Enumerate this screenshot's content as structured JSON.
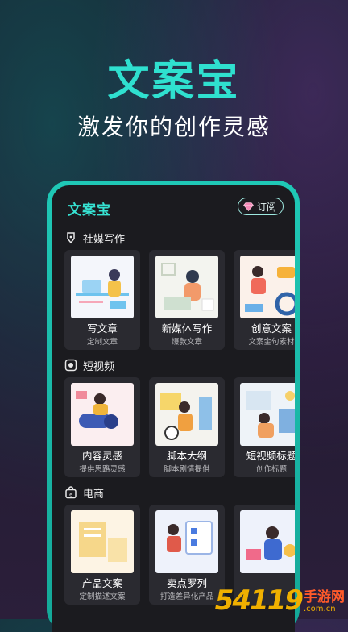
{
  "hero": {
    "title": "文案宝",
    "subtitle": "激发你的创作灵感"
  },
  "app": {
    "logo": "文案宝",
    "subscribe_label": "订阅"
  },
  "sections": [
    {
      "title": "社媒写作",
      "icon": "pen-nib-icon",
      "cards": [
        {
          "title": "写文章",
          "sub": "定制文章"
        },
        {
          "title": "新媒体写作",
          "sub": "爆款文章"
        },
        {
          "title": "创意文案",
          "sub": "文案金句素材"
        }
      ]
    },
    {
      "title": "短视频",
      "icon": "record-icon",
      "cards": [
        {
          "title": "内容灵感",
          "sub": "提供思路灵感"
        },
        {
          "title": "脚本大纲",
          "sub": "脚本剧情提供"
        },
        {
          "title": "短视频标题",
          "sub": "创作标题"
        }
      ]
    },
    {
      "title": "电商",
      "icon": "shopping-bag-icon",
      "cards": [
        {
          "title": "产品文案",
          "sub": "定制描述文案"
        },
        {
          "title": "卖点罗列",
          "sub": "打造差异化产品"
        },
        {
          "title": "",
          "sub": ""
        }
      ]
    }
  ],
  "watermark": {
    "number": "54119",
    "cn": "手游网",
    "url": ".com.cn"
  },
  "colors": {
    "accent": "#2fe0cf",
    "phone_frame": "#1fc8b6",
    "screen_bg": "#1b1b1f",
    "card_bg": "#2a2a30"
  }
}
